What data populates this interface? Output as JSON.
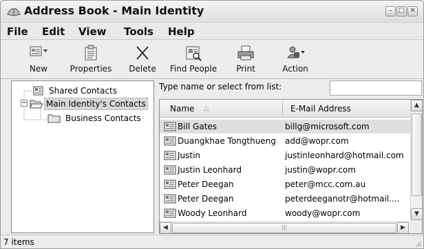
{
  "window": {
    "title": "Address Book - Main Identity",
    "min_glyph": "–",
    "max_glyph": "□",
    "close_glyph": "✕"
  },
  "menu": [
    "File",
    "Edit",
    "View",
    "Tools",
    "Help"
  ],
  "toolbar": {
    "new_label": "New",
    "properties_label": "Properties",
    "delete_label": "Delete",
    "find_people_label": "Find People",
    "print_label": "Print",
    "action_label": "Action"
  },
  "tree": {
    "items": [
      {
        "label": "Shared Contacts",
        "icon": "address-book-icon"
      },
      {
        "label": "Main Identity's Contacts",
        "icon": "folder-open-icon",
        "selected": true
      },
      {
        "label": "Business Contacts",
        "icon": "folder-icon"
      }
    ],
    "expander": "−"
  },
  "search": {
    "label": "Type name or select from list:",
    "value": ""
  },
  "list": {
    "columns": [
      "Name",
      "E-Mail Address"
    ],
    "sort_glyph": "△",
    "rows": [
      {
        "name": "Bill Gates",
        "email": "billg@microsoft.com",
        "selected": true
      },
      {
        "name": "Duangkhae Tongthueng",
        "email": "add@wopr.com"
      },
      {
        "name": "Justin",
        "email": "justinleonhard@hotmail.com"
      },
      {
        "name": "Justin Leonhard",
        "email": "justin@wopr.com"
      },
      {
        "name": "Peter Deegan",
        "email": "peter@mcc.com.au"
      },
      {
        "name": "Peter Deegan",
        "email": "peterdeeganotr@hotmail...."
      },
      {
        "name": "Woody Leonhard",
        "email": "woody@wopr.com"
      }
    ],
    "scroll_up": "▲",
    "scroll_down": "▼",
    "scroll_left": "◀",
    "scroll_right": "▶",
    "thumb_grip": "|||"
  },
  "status": {
    "text": "7 items"
  }
}
